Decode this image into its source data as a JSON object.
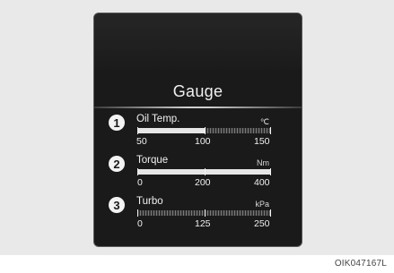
{
  "title": "Gauge",
  "gauges": [
    {
      "badge": "1",
      "name": "Oil Temp.",
      "unit": "℃",
      "min": "50",
      "mid": "100",
      "max": "150",
      "level": 0.5
    },
    {
      "badge": "2",
      "name": "Torque",
      "unit": "Nm",
      "min": "0",
      "mid": "200",
      "max": "400",
      "level": 1.0
    },
    {
      "badge": "3",
      "name": "Turbo",
      "unit": "kPa",
      "min": "0",
      "mid": "125",
      "max": "250",
      "level": 0.0
    }
  ],
  "caption": "OIK047167L"
}
